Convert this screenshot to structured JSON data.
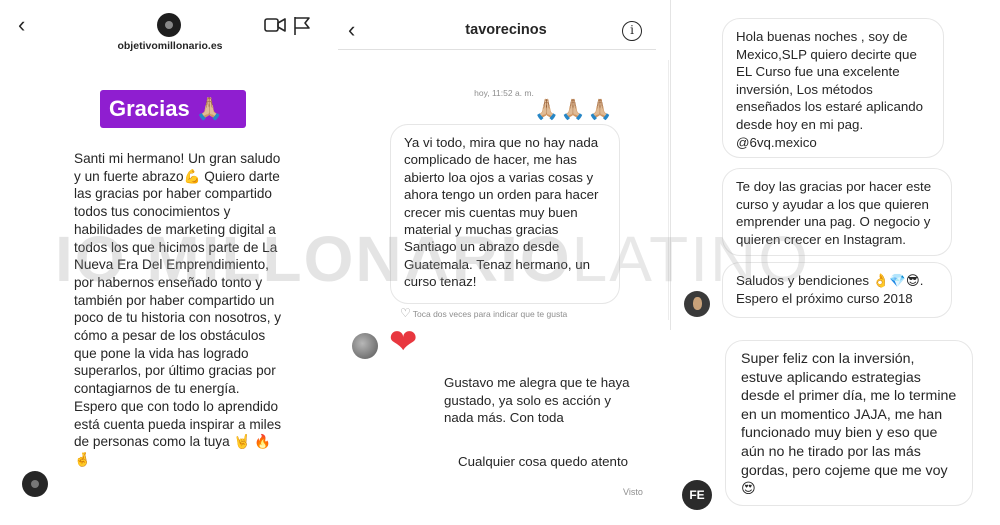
{
  "panel1": {
    "username": "objetivomillonario.es",
    "sticker_text": "Gracias",
    "sticker_emoji": "🙏🏼",
    "message": "Santi mi hermano! Un gran saludo y un fuerte abrazo💪 Quiero darte las gracias por haber compartido todos tus conocimientos y habilidades de marketing digital a todos los que hicimos parte de La Nueva Era Del Emprendimiento, por habernos enseñado tonto y también por haber compartido un poco de tu historia con nosotros, y cómo a pesar de los obstáculos que pone la vida has logrado superarlos, por último gracias por contagiarnos de tu energía. Espero que con todo lo aprendido está cuenta pueda inspirar a miles de personas como la tuya 🤘 🔥 🤞"
  },
  "panel2": {
    "title": "tavorecinos",
    "timestamp": "hoy, 11:52 a. m.",
    "emoji_row": "🙏🏼🙏🏼🙏🏼",
    "bubble_text": "Ya vi todo, mira que no hay nada complicado de hacer, me has abierto loa ojos a varias cosas y ahora tengo un orden para hacer crecer mis cuentas muy buen material y muchas gracias Santiago un abrazo desde Guatemala. Tenaz hermano, un curso tenaz!",
    "like_hint": "Toca dos veces para indicar que te gusta",
    "reply1": "Gustavo me alegra que te haya gustado, ya solo es acción y nada más. Con toda",
    "reply2": "Cualquier cosa quedo atento",
    "seen": "Visto"
  },
  "panel3": {
    "bubble1": "Hola buenas noches , soy de Mexico,SLP quiero decirte que EL Curso fue una excelente inversión, Los métodos enseñados los estaré aplicando desde hoy en mi pag. @6vq.mexico",
    "bubble2": "Te doy las gracias por hacer este curso y ayudar a los que quieren emprender una pag. O negocio y quieren crecer en Instagram.",
    "bubble3": "Saludos y bendiciones 👌💎😎. Espero el próximo curso 2018",
    "bubble4": "Super feliz con la inversión, estuve aplicando estrategias desde el primer día, me lo termine en un momentico JAJA, me han funcionado muy bien y eso que aún no he tirado por las más gordas, pero cojeme que me voy😍",
    "avatar2_initials": "FE"
  },
  "watermark": {
    "bold_part": "MILLONARIO",
    "light_part": "LATINO",
    "prefix": "IO"
  },
  "icons": {
    "back": "chevron-left-icon",
    "video": "video-camera-icon",
    "flag": "flag-icon",
    "info": "info-icon",
    "heart": "heart-icon"
  },
  "colors": {
    "sticker_bg": "#8f1ed0",
    "heart": "#e8373f",
    "muted_text": "#8e8e8e"
  }
}
